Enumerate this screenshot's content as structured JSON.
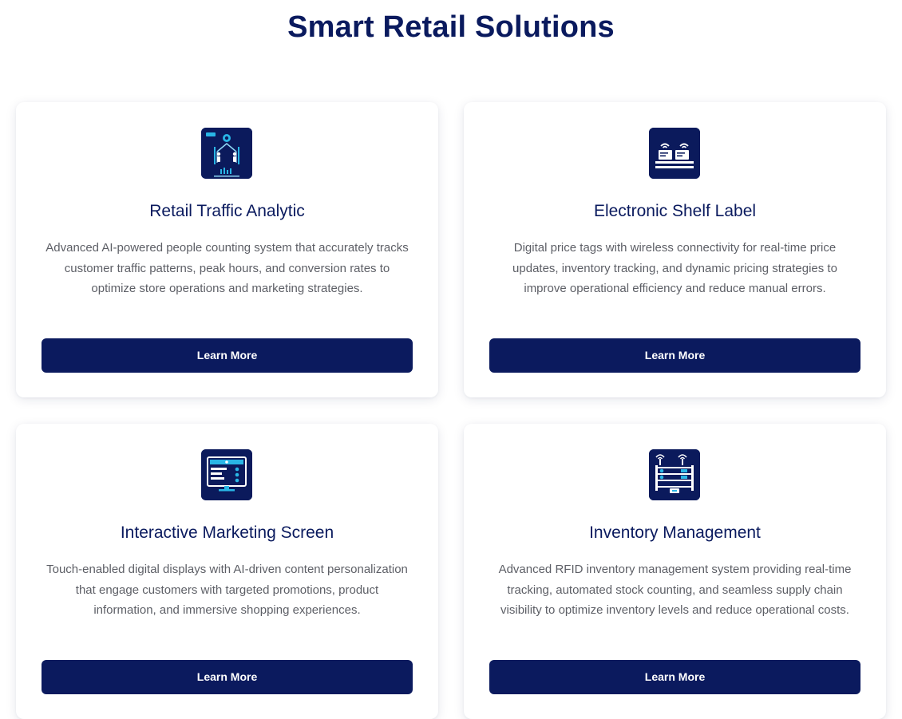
{
  "page": {
    "title": "Smart Retail Solutions"
  },
  "colors": {
    "primary": "#0b1a5e",
    "accent": "#29b6e6",
    "text_muted": "#5d5f66"
  },
  "cards": [
    {
      "icon": "people-counter-icon",
      "title": "Retail Traffic Analytic",
      "description": "Advanced AI-powered people counting system that accurately tracks customer traffic patterns, peak hours, and conversion rates to optimize store operations and marketing strategies.",
      "button_label": "Learn More"
    },
    {
      "icon": "shelf-label-icon",
      "title": "Electronic Shelf Label",
      "description": "Digital price tags with wireless connectivity for real-time price updates, inventory tracking, and dynamic pricing strategies to improve operational efficiency and reduce manual errors.",
      "button_label": "Learn More"
    },
    {
      "icon": "marketing-screen-icon",
      "title": "Interactive Marketing Screen",
      "description": "Touch-enabled digital displays with AI-driven content personalization that engage customers with targeted promotions, product information, and immersive shopping experiences.",
      "button_label": "Learn More"
    },
    {
      "icon": "rfid-inventory-icon",
      "title": "Inventory Management",
      "description": "Advanced RFID inventory management system providing real-time tracking, automated stock counting, and seamless supply chain visibility to optimize inventory levels and reduce operational costs.",
      "button_label": "Learn More"
    }
  ]
}
